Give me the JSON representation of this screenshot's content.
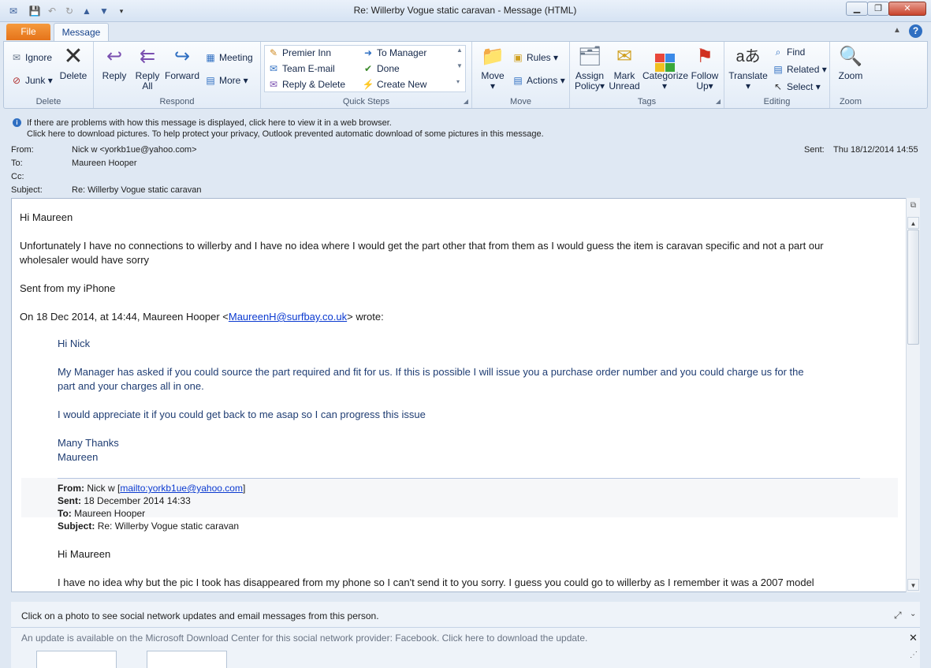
{
  "window": {
    "title": "Re: Willerby Vogue static caravan  -  Message (HTML)"
  },
  "tabs": {
    "file": "File",
    "message": "Message"
  },
  "ribbon": {
    "delete": {
      "ignore": "Ignore",
      "junk": "Junk",
      "delete": "Delete",
      "label": "Delete"
    },
    "respond": {
      "reply": "Reply",
      "reply_all_1": "Reply",
      "reply_all_2": "All",
      "forward": "Forward",
      "meeting": "Meeting",
      "more": "More",
      "label": "Respond"
    },
    "quicksteps": {
      "premier_inn": "Premier Inn",
      "team_email": "Team E-mail",
      "reply_delete": "Reply & Delete",
      "to_manager": "To Manager",
      "done": "Done",
      "create_new": "Create New",
      "label": "Quick Steps"
    },
    "move": {
      "move": "Move",
      "rules": "Rules",
      "actions": "Actions",
      "label": "Move"
    },
    "tags": {
      "assign_1": "Assign",
      "assign_2": "Policy",
      "mark_1": "Mark",
      "mark_2": "Unread",
      "categorize": "Categorize",
      "follow_1": "Follow",
      "follow_2": "Up",
      "label": "Tags"
    },
    "editing": {
      "translate": "Translate",
      "find": "Find",
      "related": "Related",
      "select": "Select",
      "label": "Editing"
    },
    "zoom": {
      "zoom": "Zoom",
      "label": "Zoom"
    }
  },
  "info": {
    "line1": "If there are problems with how this message is displayed, click here to view it in a web browser.",
    "line2": "Click here to download pictures. To help protect your privacy, Outlook prevented automatic download of some pictures in this message."
  },
  "header": {
    "from_label": "From:",
    "from": "Nick w <yorkb1ue@yahoo.com>",
    "to_label": "To:",
    "to": "Maureen Hooper",
    "cc_label": "Cc:",
    "subject_label": "Subject:",
    "subject": "Re: Willerby Vogue static caravan",
    "sent_label": "Sent:",
    "sent": "Thu 18/12/2014 14:55"
  },
  "body": {
    "greeting": "Hi Maureen",
    "para1": "Unfortunately I have no connections to willerby and I have no idea where I would get the part other that from them as I would guess the item is caravan specific and not a part our",
    "para1b": "wholesaler would have sorry",
    "sig": "Sent from my iPhone",
    "wrote_pre": "On 18 Dec 2014, at 14:44, Maureen Hooper <",
    "wrote_email": "MaureenH@surfbay.co.uk",
    "wrote_post": "> wrote:",
    "q_greeting": "Hi Nick",
    "q_para1": "My Manager has asked if you could source the part required and fit for us.  If this is possible I will issue you a purchase order number and you could charge us for the",
    "q_para1b": "part and your charges all in one.",
    "q_para2": "I would appreciate it if you could get back to me asap so I can progress this issue",
    "q_thanks": "Many Thanks",
    "q_name": "Maureen",
    "fwd_from_label": "From:",
    "fwd_from": "Nick w ",
    "fwd_mailto": "mailto:yorkb1ue@yahoo.com",
    "fwd_sent_label": "Sent:",
    "fwd_sent": "18 December 2014 14:33",
    "fwd_to_label": "To:",
    "fwd_to": "Maureen Hooper",
    "fwd_subject_label": "Subject:",
    "fwd_subject": "Re: Willerby Vogue static caravan",
    "fwd_greeting": "Hi Maureen",
    "fwd_para": "I have no idea why but the pic I took has disappeared from my phone so I can't send it to you sorry. I guess you could go to willerby as I remember it was a 2007 model"
  },
  "people": {
    "line1": "Click on a photo to see social network updates and email messages from this person.",
    "line2": "An update is available on the Microsoft Download Center for this social network provider: Facebook. Click here to download the update."
  }
}
